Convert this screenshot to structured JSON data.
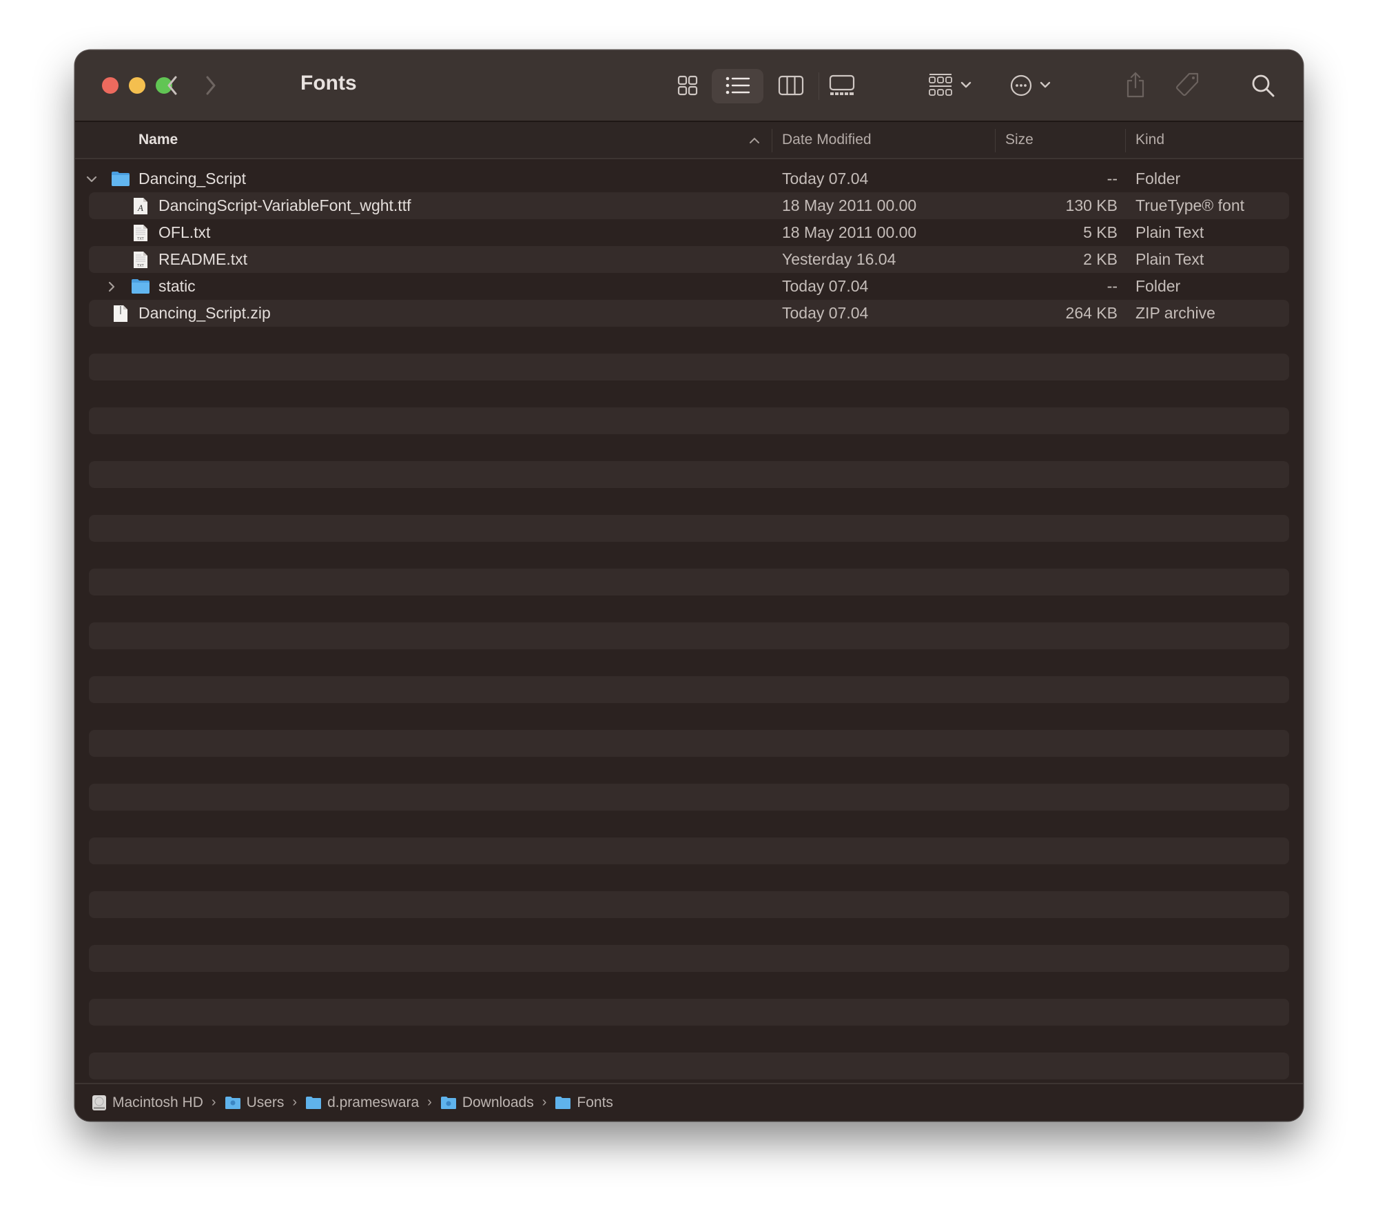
{
  "window": {
    "title": "Fonts",
    "traffic_lights": {
      "close": "#ec6a5e",
      "minimize": "#f4bf4f",
      "zoom": "#61c554"
    }
  },
  "toolbar": {
    "back_icon": "chevron-left-icon",
    "forward_icon": "chevron-right-icon",
    "view_modes": [
      "icons",
      "list",
      "columns",
      "gallery"
    ],
    "active_view": "list",
    "group_icon": "group-by-icon",
    "action_icon": "ellipsis-circle-icon",
    "share_icon": "share-icon",
    "tag_icon": "tag-icon",
    "search_icon": "search-icon"
  },
  "columns": {
    "name": "Name",
    "date_modified": "Date Modified",
    "size": "Size",
    "kind": "Kind",
    "sort_column": "Name",
    "sort_direction": "ascending"
  },
  "files": [
    {
      "name": "Dancing_Script",
      "date": "Today 07.04",
      "size": "--",
      "kind": "Folder",
      "icon": "folder-icon",
      "level": 0,
      "disclosure": "expanded"
    },
    {
      "name": "DancingScript-VariableFont_wght.ttf",
      "date": "18 May 2011 00.00",
      "size": "130 KB",
      "kind": "TrueType® font",
      "icon": "font-file-icon",
      "level": 1,
      "disclosure": "none"
    },
    {
      "name": "OFL.txt",
      "date": "18 May 2011 00.00",
      "size": "5 KB",
      "kind": "Plain Text",
      "icon": "text-file-icon",
      "level": 1,
      "disclosure": "none"
    },
    {
      "name": "README.txt",
      "date": "Yesterday 16.04",
      "size": "2 KB",
      "kind": "Plain Text",
      "icon": "text-file-icon",
      "level": 1,
      "disclosure": "none"
    },
    {
      "name": "static",
      "date": "Today 07.04",
      "size": "--",
      "kind": "Folder",
      "icon": "folder-icon",
      "level": 1,
      "disclosure": "collapsed"
    },
    {
      "name": "Dancing_Script.zip",
      "date": "Today 07.04",
      "size": "264 KB",
      "kind": "ZIP archive",
      "icon": "zip-file-icon",
      "level": 0,
      "disclosure": "none"
    }
  ],
  "pathbar": [
    {
      "label": "Macintosh HD",
      "icon": "hard-drive-icon"
    },
    {
      "label": "Users",
      "icon": "users-folder-icon"
    },
    {
      "label": "d.prameswara",
      "icon": "folder-icon"
    },
    {
      "label": "Downloads",
      "icon": "downloads-folder-icon"
    },
    {
      "label": "Fonts",
      "icon": "folder-icon"
    }
  ],
  "colors": {
    "folder_blue": "#5fb3ec",
    "window_bg": "#2b2220",
    "toolbar_bg": "#3c3431"
  }
}
